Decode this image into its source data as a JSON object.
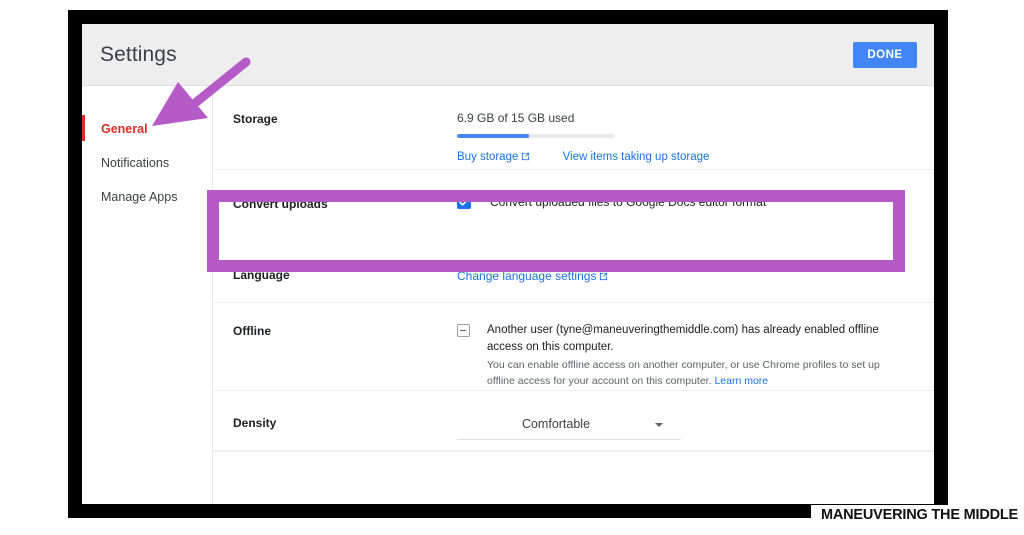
{
  "header": {
    "title": "Settings",
    "done_label": "DONE"
  },
  "sidebar": {
    "items": [
      {
        "label": "General",
        "active": true
      },
      {
        "label": "Notifications",
        "active": false
      },
      {
        "label": "Manage Apps",
        "active": false
      }
    ]
  },
  "rows": {
    "storage": {
      "label": "Storage",
      "used_text": "6.9 GB of 15 GB used",
      "progress_percent": 46,
      "buy_link": "Buy storage",
      "view_link": "View items taking up storage"
    },
    "convert": {
      "label": "Convert uploads",
      "checkbox_label": "Convert uploaded files to Google Docs editor format",
      "checked": true
    },
    "language": {
      "label": "Language",
      "link": "Change language settings"
    },
    "offline": {
      "label": "Offline",
      "main_text": "Another user (tyne@maneuveringthemiddle.com) has already enabled offline access on this computer.",
      "sub_text": "You can enable offline access on another computer, or use Chrome profiles to set up offline access for your account on this computer.",
      "learn_more": "Learn more",
      "checkbox_state": "indeterminate"
    },
    "density": {
      "label": "Density",
      "selected": "Comfortable"
    }
  },
  "watermark": {
    "text": "MANEUVERING THE MIDDLE"
  },
  "colors": {
    "accent_blue": "#1a73e8",
    "button_blue": "#4285f4",
    "active_red": "#d93025",
    "annotation_purple": "#b55bc8",
    "header_gray": "#eeeeee"
  }
}
